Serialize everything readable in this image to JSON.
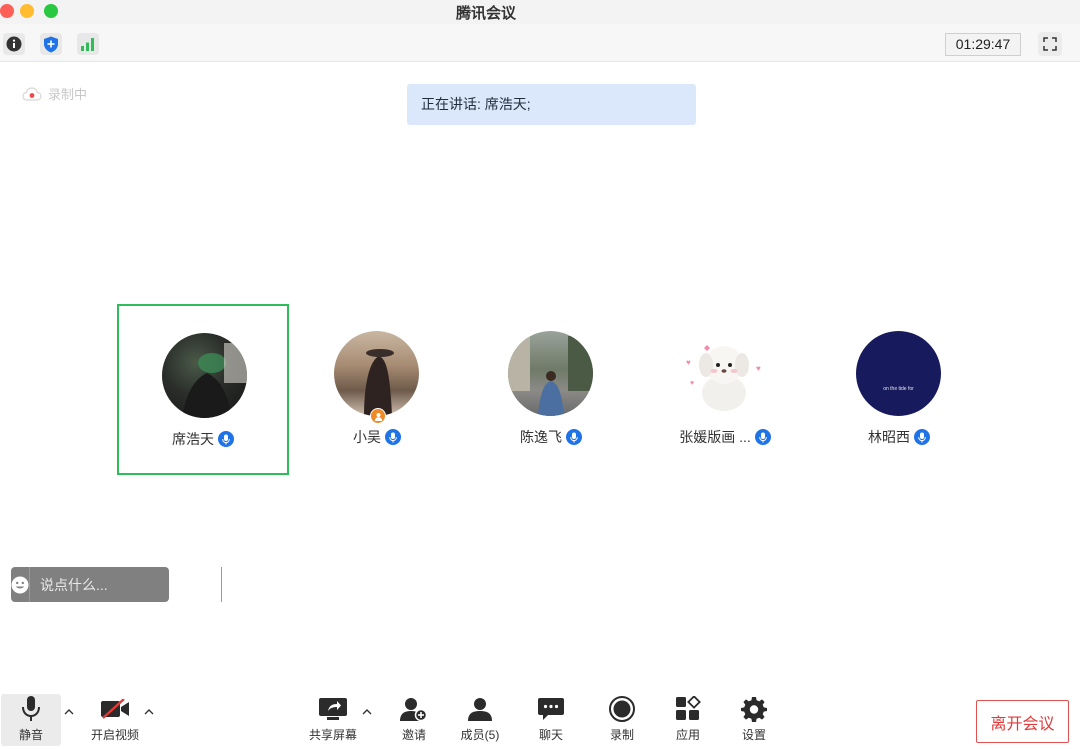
{
  "app": {
    "title": "腾讯会议"
  },
  "toolbar": {
    "timer": "01:29:47"
  },
  "recording": {
    "label": "录制中"
  },
  "speaking": {
    "text": "正在讲话: 席浩天;"
  },
  "participants": [
    {
      "name": "席浩天"
    },
    {
      "name": "小吴"
    },
    {
      "name": "陈逸飞"
    },
    {
      "name": "张媛版画 ..."
    },
    {
      "name": "林昭西",
      "avatar_caption": "on the tide for"
    }
  ],
  "chat": {
    "placeholder": "说点什么..."
  },
  "bottom": {
    "mute": "静音",
    "video": "开启视频",
    "share": "共享屏幕",
    "invite": "邀请",
    "members": "成员(5)",
    "chat": "聊天",
    "record": "录制",
    "apps": "应用",
    "settings": "设置",
    "leave": "离开会议"
  },
  "colors": {
    "accent": "#1f73e6",
    "active_border": "#2ebd59",
    "leave": "#e03a3a"
  },
  "icons": [
    "info-icon",
    "shield-icon",
    "signal-icon",
    "fullscreen-icon",
    "cloud-record-icon",
    "microphone-icon",
    "video-off-icon",
    "share-screen-icon",
    "invite-icon",
    "members-icon",
    "chat-icon",
    "record-icon",
    "apps-icon",
    "gear-icon"
  ]
}
